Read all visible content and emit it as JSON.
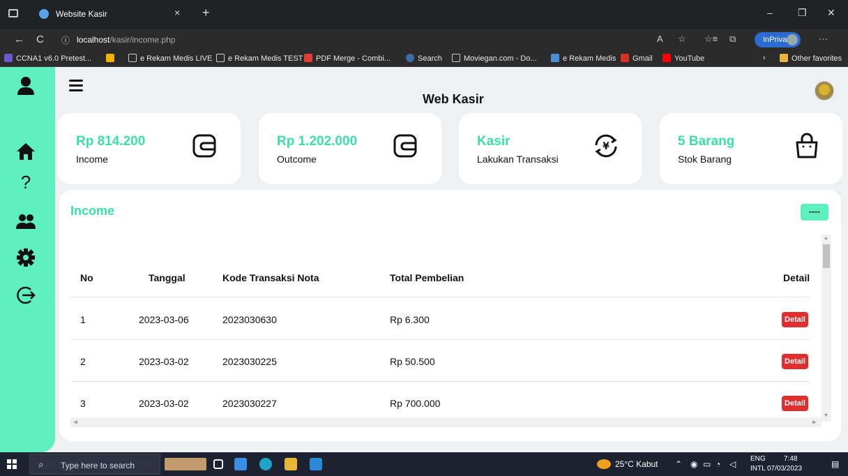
{
  "browser": {
    "tab_title": "Website Kasir",
    "tab_close": "×",
    "new_tab": "+",
    "url_host": "localhost",
    "url_path": "/kasir/income.php",
    "inprivate_label": "InPrivate",
    "more": "···",
    "win_min": "–",
    "win_restore": "❐",
    "win_close": "✕",
    "back": "←",
    "reload": "C",
    "info": "ⓘ",
    "read_aloud": "A",
    "favorite": "☆",
    "favorites_bar": "☆≡",
    "collections": "⧉"
  },
  "bookmarks": [
    {
      "label": "CCNA1 v6.0 Pretest...",
      "color": "#6a5acd"
    },
    {
      "label": "",
      "color": "#f0b400"
    },
    {
      "label": "e Rekam Medis LIVE",
      "color": "#2b2b2b"
    },
    {
      "label": "e Rekam Medis TEST",
      "color": "#2b2b2b"
    },
    {
      "label": "PDF Merge - Combi...",
      "color": "#e03c31"
    },
    {
      "label": "Search",
      "color": "#3a6ea5"
    },
    {
      "label": "Moviegan.com - Do...",
      "color": "#2b2b2b"
    },
    {
      "label": "e Rekam Medis",
      "color": "#4a8fd8"
    },
    {
      "label": "Gmail",
      "color": "#d93025"
    },
    {
      "label": "YouTube",
      "color": "#ff0000"
    }
  ],
  "bookmarks_more": "›",
  "other_favorites": "Other favorites",
  "app": {
    "title": "Web Kasir"
  },
  "cards": [
    {
      "value": "Rp 814.200",
      "label": "Income",
      "icon": "wallet-icon"
    },
    {
      "value": "Rp 1.202.000",
      "label": "Outcome",
      "icon": "wallet-icon"
    },
    {
      "value": "Kasir",
      "label": "Lakukan Transaksi",
      "icon": "currency-exchange-icon"
    },
    {
      "value": "5 Barang",
      "label": "Stok Barang",
      "icon": "shopping-bag-icon"
    }
  ],
  "panel": {
    "title": "Income",
    "button_label": "----"
  },
  "table": {
    "headers": [
      "No",
      "Tanggal",
      "Kode Transaksi Nota",
      "Total Pembelian",
      "Detail"
    ],
    "rows": [
      {
        "no": "1",
        "tanggal": "2023-03-06",
        "kode": "2023030630",
        "total": "Rp 6.300",
        "detail": "Detail"
      },
      {
        "no": "2",
        "tanggal": "2023-03-02",
        "kode": "2023030225",
        "total": "Rp 50.500",
        "detail": "Detail"
      },
      {
        "no": "3",
        "tanggal": "2023-03-02",
        "kode": "2023030227",
        "total": "Rp 700.000",
        "detail": "Detail"
      }
    ]
  },
  "taskbar": {
    "search_placeholder": "Type here to search",
    "weather": "25°C Kabut",
    "lang_top": "ENG",
    "lang_bottom": "INTL",
    "time": "7:48",
    "date": "07/03/2023"
  },
  "colors": {
    "accent": "#5ff0c0",
    "accent_text": "#3be0a8",
    "danger": "#e02d2d"
  }
}
